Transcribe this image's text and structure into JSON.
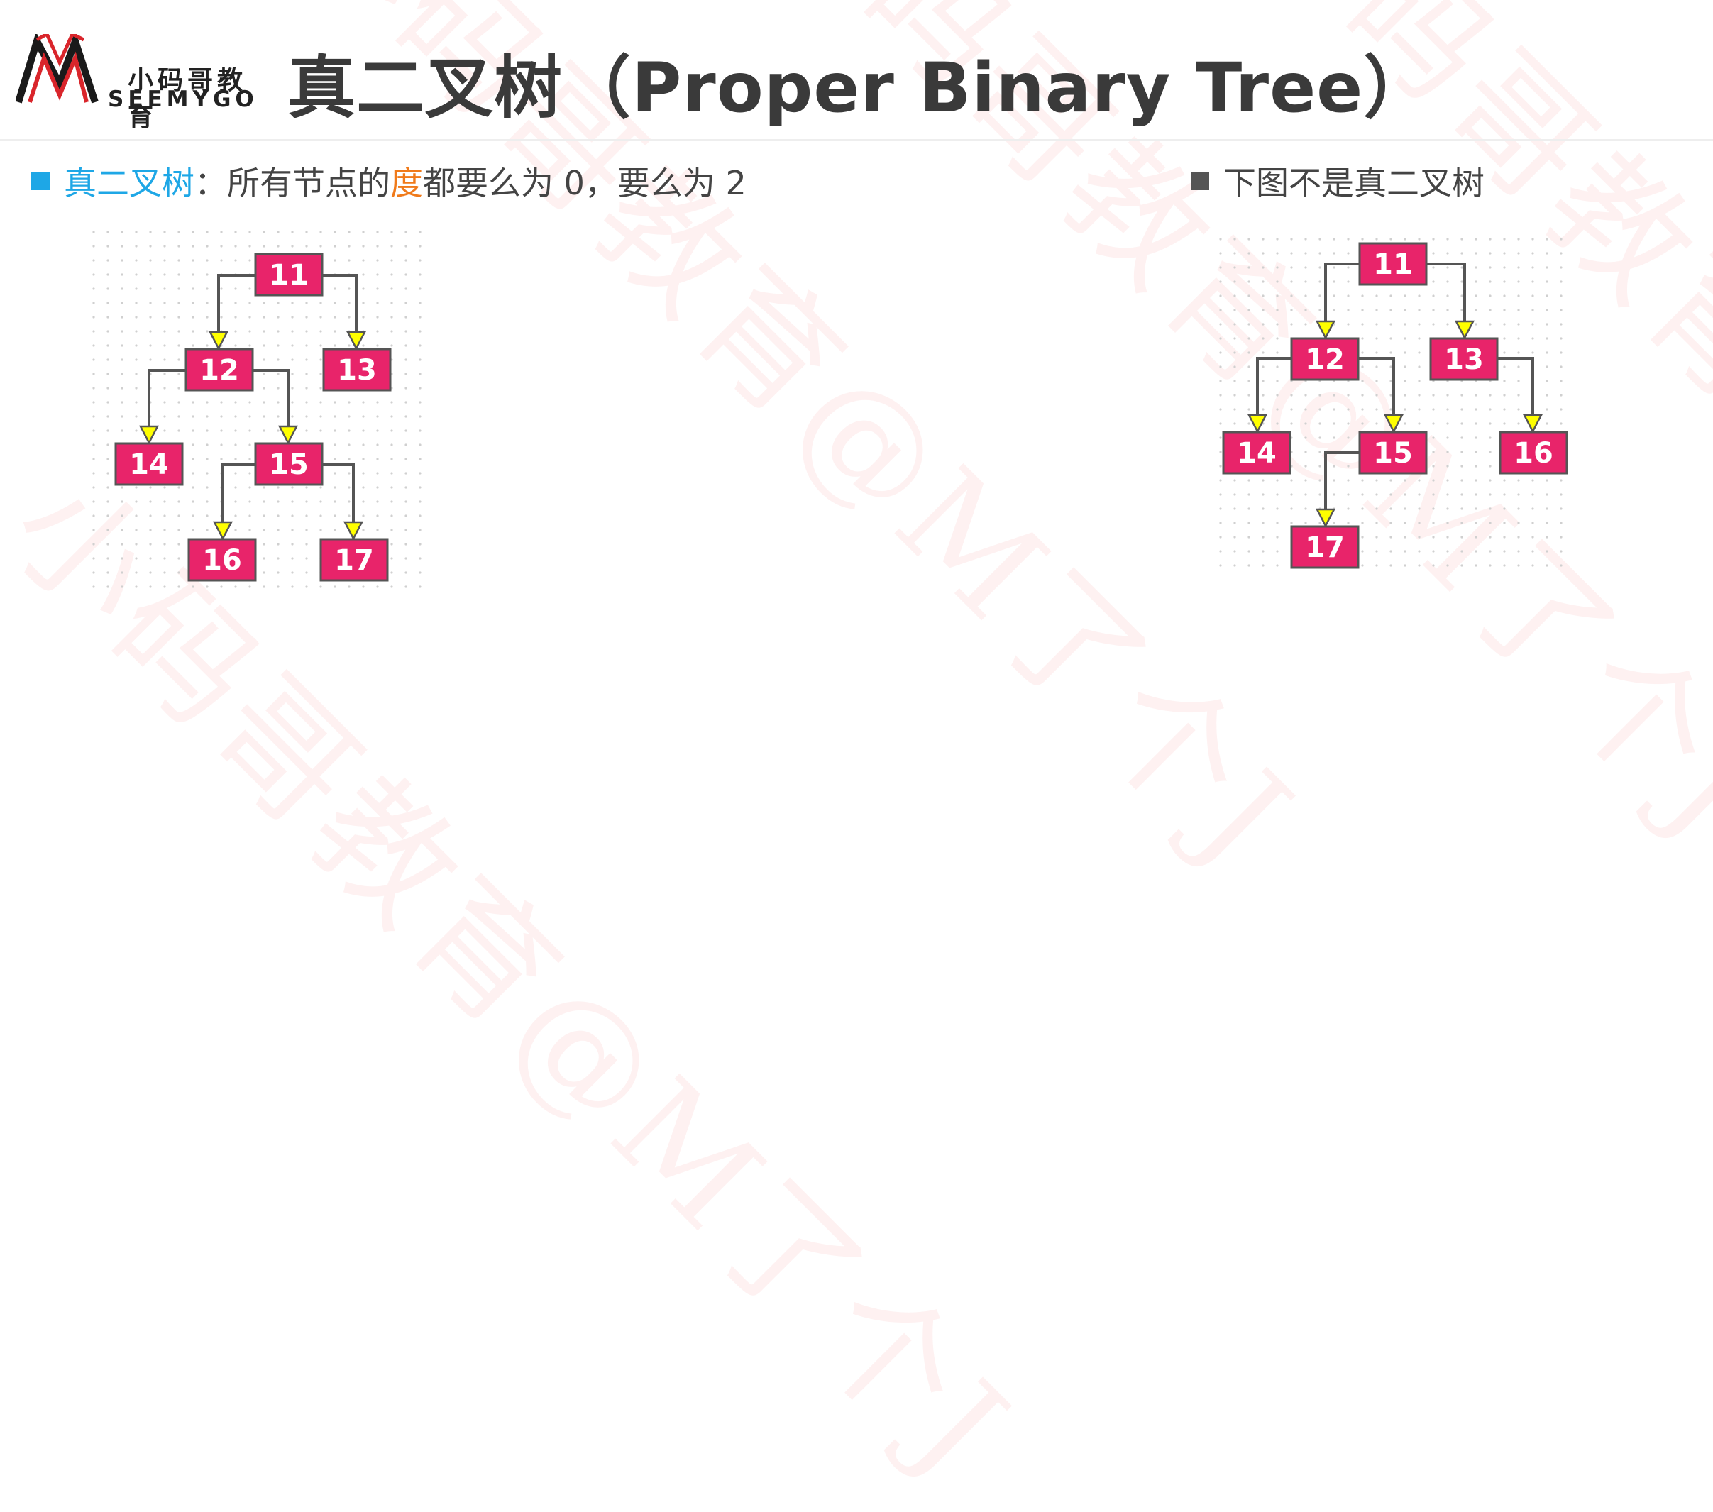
{
  "logo": {
    "zh_text": "小码哥教育",
    "en_text": "SEEMYGO"
  },
  "title": "真二叉树（Proper Binary Tree）",
  "left_panel": {
    "bullet_term": "真二叉树",
    "colon": "：所有节点的",
    "degree_term": "度",
    "rest": "都要么为 0，要么为 2"
  },
  "right_panel": {
    "caption": "下图不是真二叉树"
  },
  "watermark_text": "小码哥教育@M了个J",
  "colors": {
    "node_fill": "#e8246a",
    "arrow_fill": "#ffff00",
    "edge": "#555555",
    "accent_blue": "#1ea7e6",
    "accent_orange": "#f07a1a",
    "bullet_right": "#555555"
  },
  "left_tree": {
    "nodes": [
      "11",
      "12",
      "13",
      "14",
      "15",
      "16",
      "17"
    ]
  },
  "right_tree": {
    "nodes": [
      "11",
      "12",
      "13",
      "14",
      "15",
      "16",
      "17"
    ]
  }
}
